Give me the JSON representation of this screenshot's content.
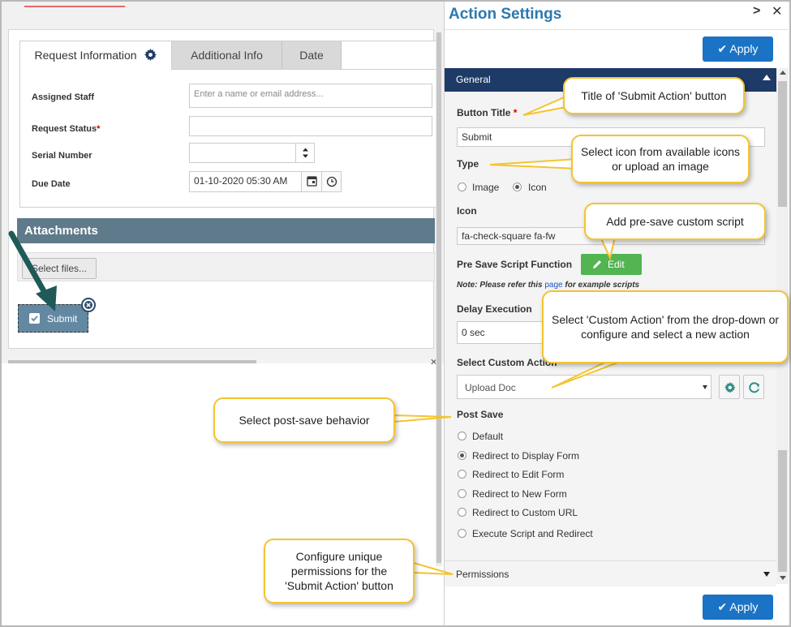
{
  "form": {
    "tabs": [
      {
        "label": "Request Information",
        "icon": "gear-icon",
        "active": true
      },
      {
        "label": "Additional Info",
        "active": false
      },
      {
        "label": "Date",
        "active": false
      }
    ],
    "fields": {
      "assigned_staff": {
        "label": "Assigned Staff",
        "placeholder": "Enter a name or email address..."
      },
      "request_status": {
        "label": "Request Status",
        "required_mark": "*",
        "value": ""
      },
      "serial_number": {
        "label": "Serial Number",
        "value": ""
      },
      "due_date": {
        "label": "Due Date",
        "value": "01-10-2020 05:30 AM"
      }
    },
    "attachments": {
      "title": "Attachments",
      "select_button": "Select files..."
    },
    "submit_preview": {
      "label": "Submit"
    }
  },
  "panel": {
    "title": "Action Settings",
    "apply_label": "Apply",
    "general": {
      "header": "General",
      "button_title": {
        "label": "Button Title",
        "required_mark": "*",
        "value": "Submit"
      },
      "type": {
        "label": "Type",
        "options": [
          "Image",
          "Icon"
        ],
        "selected": "Icon"
      },
      "icon": {
        "label": "Icon",
        "value": "fa-check-square fa-fw"
      },
      "pre_save": {
        "label": "Pre Save Script Function",
        "edit_label": "Edit"
      },
      "note": {
        "prefix": "Note: Please refer this ",
        "link": "page",
        "suffix": " for example scripts"
      },
      "delay": {
        "label": "Delay Execution",
        "value": "0 sec"
      },
      "custom_action": {
        "label": "Select Custom Action",
        "value": "Upload Doc"
      },
      "post_save": {
        "label": "Post Save",
        "options": [
          "Default",
          "Redirect to Display Form",
          "Redirect to Edit Form",
          "Redirect to New Form",
          "Redirect to Custom URL",
          "Execute Script and Redirect"
        ],
        "selected": "Redirect to Display Form"
      }
    },
    "permissions": {
      "label": "Permissions"
    }
  },
  "callouts": {
    "title": "Title of 'Submit Action' button",
    "icon": "Select icon from available icons or upload an image",
    "script": "Add pre-save custom script",
    "custom_action": "Select 'Custom Action' from the drop-down or configure and select a new action",
    "post_save": "Select post-save behavior",
    "permissions": "Configure unique permissions for the 'Submit Action' button"
  },
  "colors": {
    "accent": "#2b78b0",
    "apply": "#1a73c4",
    "header": "#1e3a66",
    "edit": "#52b552",
    "attachments_bar": "#5f7a8a",
    "callout_border": "#f4c430",
    "arrow": "#1f5a58"
  }
}
